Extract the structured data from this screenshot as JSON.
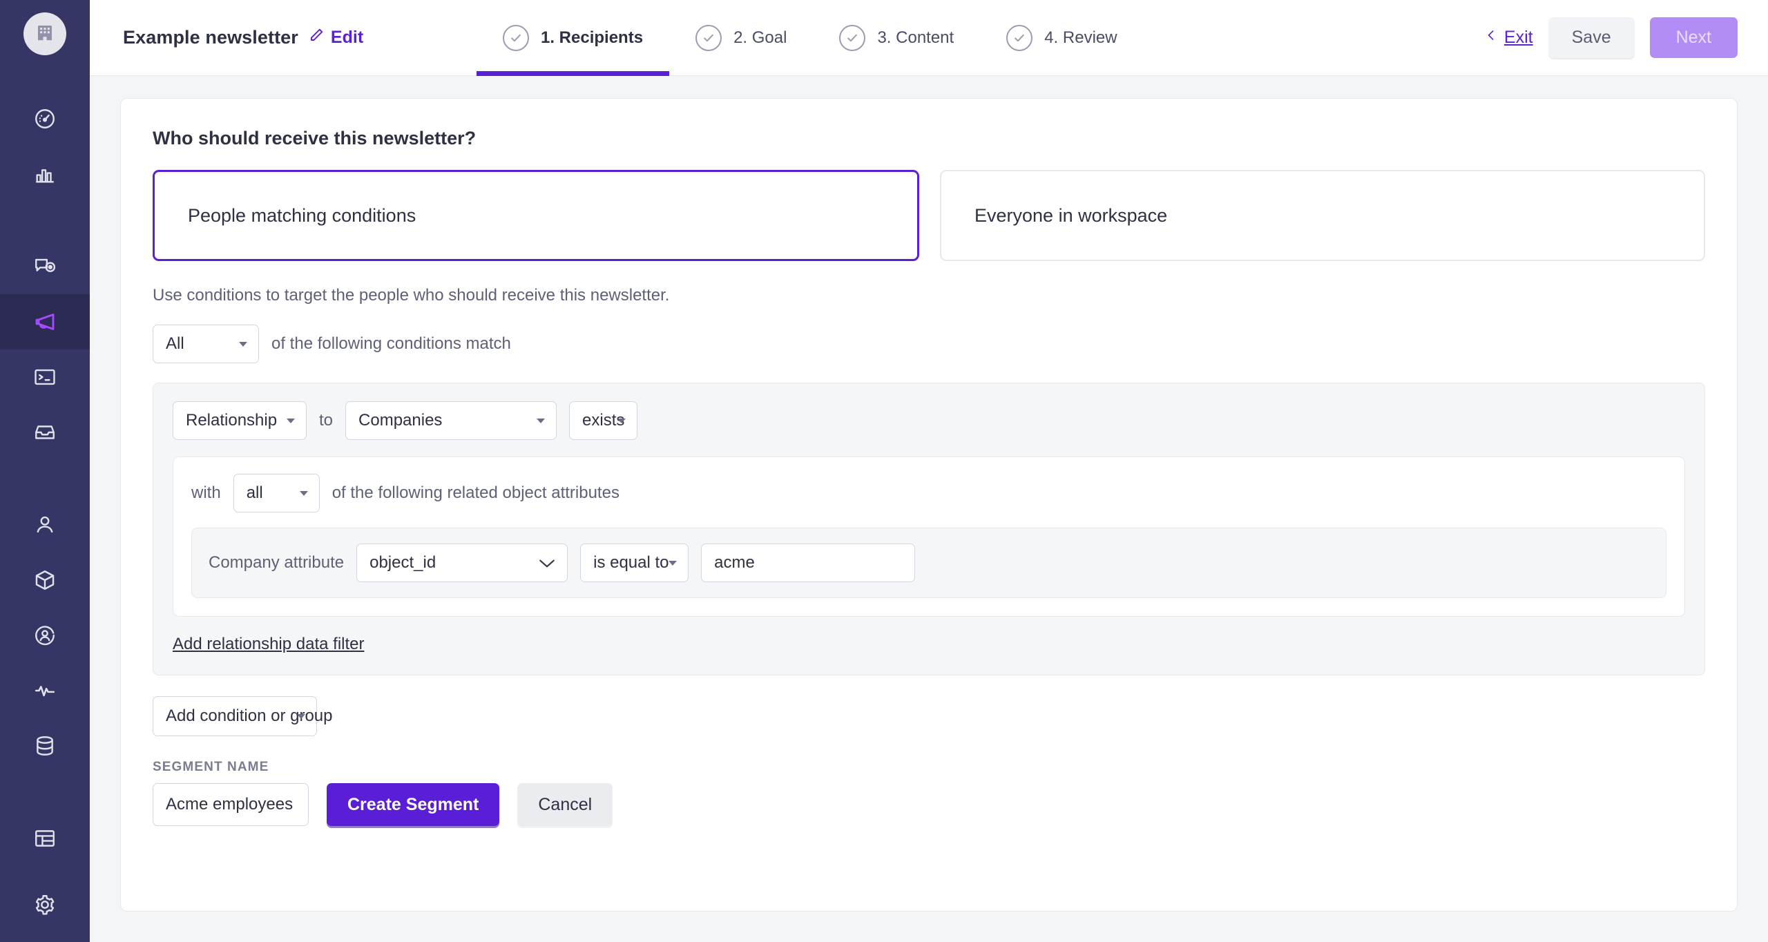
{
  "sidebar": {
    "logo_icon": "building-icon",
    "items": [
      {
        "icon": "dashboard-gauge-icon",
        "active": false
      },
      {
        "icon": "bar-chart-icon",
        "active": false
      },
      {
        "icon": "message-eye-icon",
        "active": false
      },
      {
        "icon": "megaphone-icon",
        "active": true
      },
      {
        "icon": "terminal-icon",
        "active": false
      },
      {
        "icon": "inbox-icon",
        "active": false
      },
      {
        "icon": "person-icon",
        "active": false
      },
      {
        "icon": "cube-icon",
        "active": false
      },
      {
        "icon": "user-circle-icon",
        "active": false
      },
      {
        "icon": "activity-pulse-icon",
        "active": false
      },
      {
        "icon": "database-icon",
        "active": false
      },
      {
        "icon": "layout-table-icon",
        "active": false
      },
      {
        "icon": "gear-icon",
        "active": false
      }
    ]
  },
  "header": {
    "document_title": "Example newsletter",
    "edit_label": "Edit",
    "edit_icon": "pencil-icon",
    "steps": [
      {
        "label": "1. Recipients",
        "icon": "check-circle-icon",
        "active": true
      },
      {
        "label": "2. Goal",
        "icon": "check-circle-icon",
        "active": false
      },
      {
        "label": "3. Content",
        "icon": "check-circle-icon",
        "active": false
      },
      {
        "label": "4. Review",
        "icon": "check-circle-icon",
        "active": false
      }
    ],
    "exit_label": "Exit",
    "exit_icon": "chevron-left-icon",
    "save_label": "Save",
    "next_label": "Next"
  },
  "main": {
    "panel_title": "Who should receive this newsletter?",
    "choices": [
      {
        "label": "People matching conditions",
        "selected": true
      },
      {
        "label": "Everyone in workspace",
        "selected": false
      }
    ],
    "helper_text": "Use conditions to target the people who should receive this newsletter.",
    "match_mode": {
      "value": "All",
      "suffix_text": "of the following conditions match"
    },
    "condition": {
      "type_value": "Relationship",
      "to_label": "to",
      "object_value": "Companies",
      "operator_value": "exists",
      "with_label": "with",
      "quantifier_value": "all",
      "quantifier_suffix": "of the following related object attributes",
      "attribute_label": "Company attribute",
      "attribute_value": "object_id",
      "comparator_value": "is equal to",
      "attribute_input_value": "acme",
      "add_filter_link": "Add relationship data filter"
    },
    "add_condition_label": "Add condition or group",
    "segment_name_label": "SEGMENT NAME",
    "segment_name_value": "Acme employees",
    "create_segment_label": "Create Segment",
    "cancel_label": "Cancel"
  },
  "colors": {
    "sidebar_bg": "#353566",
    "sidebar_active_bg": "#2B2B54",
    "sidebar_active_icon": "#A54BFF",
    "accent_purple": "#5A1ED6",
    "next_disabled": "#B28DF5",
    "page_bg": "#F4F5F7",
    "group_bg": "#F5F6F8",
    "border": "#E6E8ED"
  }
}
